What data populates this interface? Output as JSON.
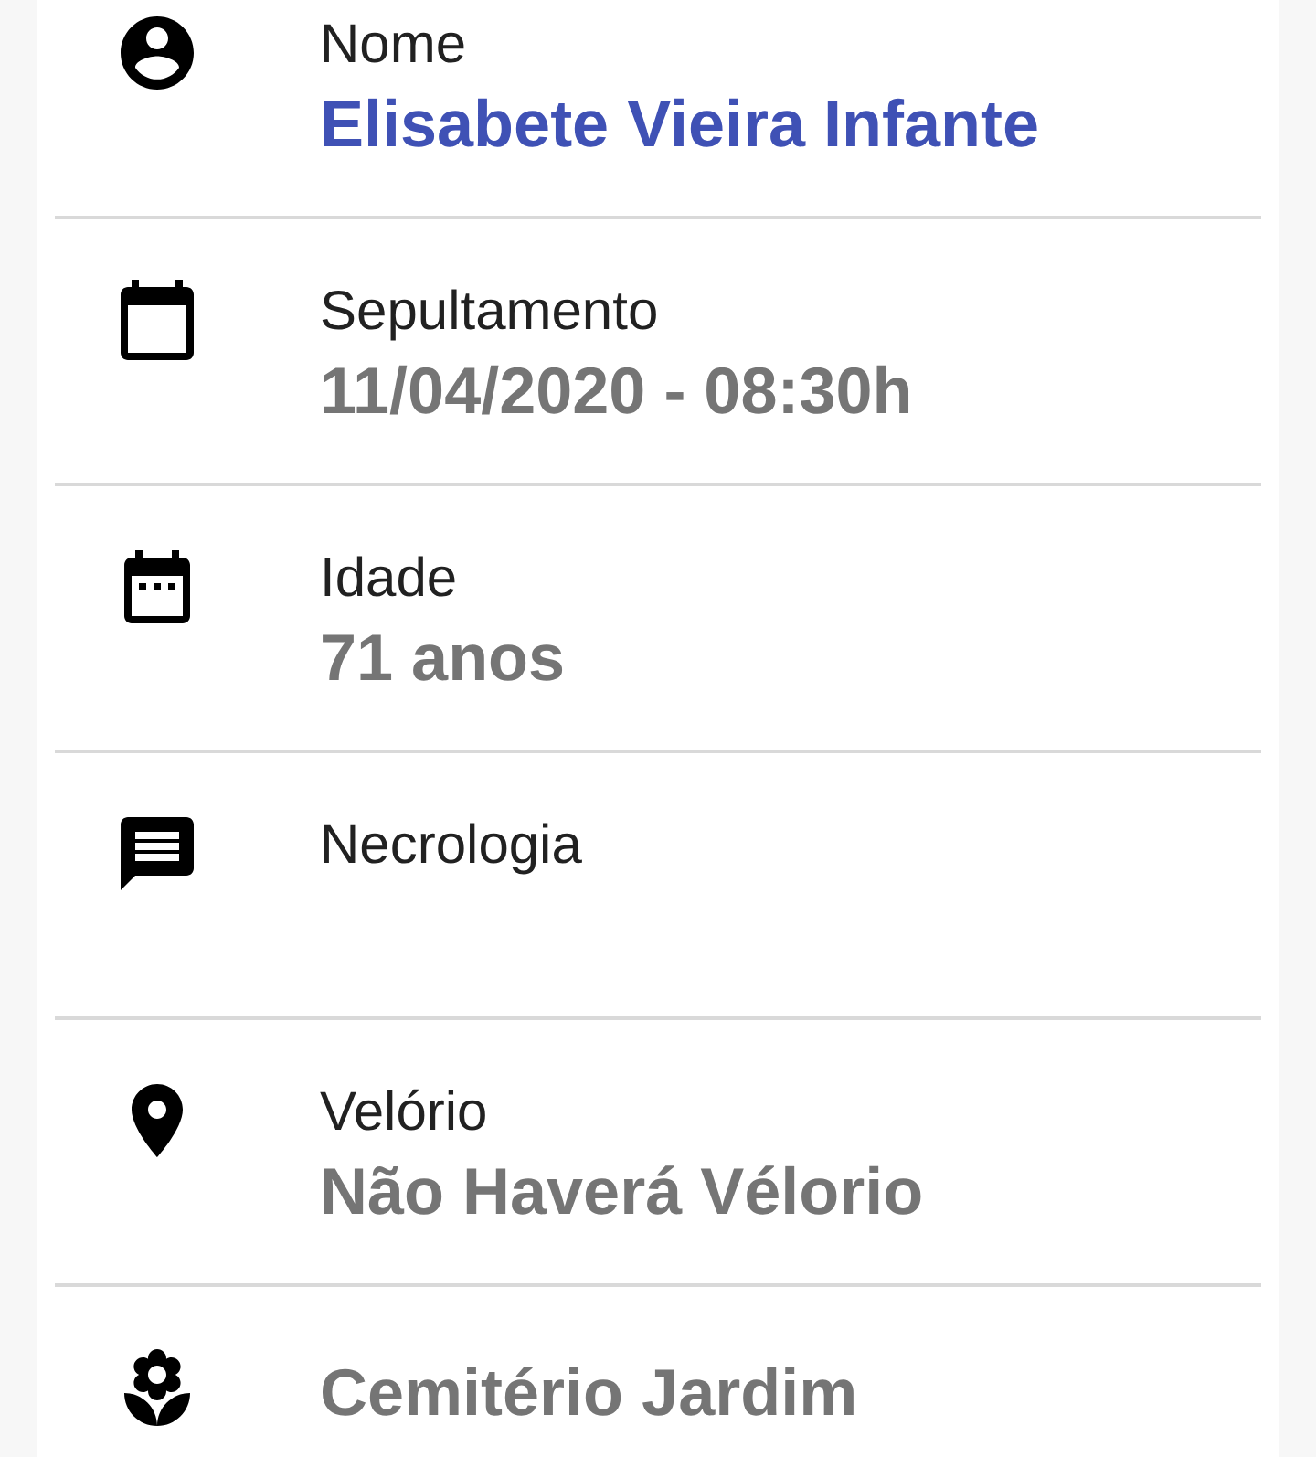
{
  "details": [
    {
      "kind": "name",
      "label": "Nome",
      "value": "Elisabete Vieira Infante"
    },
    {
      "kind": "burial",
      "label": "Sepultamento",
      "value": "11/04/2020 - 08:30h"
    },
    {
      "kind": "age",
      "label": "Idade",
      "value": "71 anos"
    },
    {
      "kind": "obituary",
      "label": "Necrologia"
    },
    {
      "kind": "wake",
      "label": "Velório",
      "value": "Não Haverá Vélorio"
    },
    {
      "kind": "cemetery",
      "value": "Cemitério Jardim"
    }
  ]
}
